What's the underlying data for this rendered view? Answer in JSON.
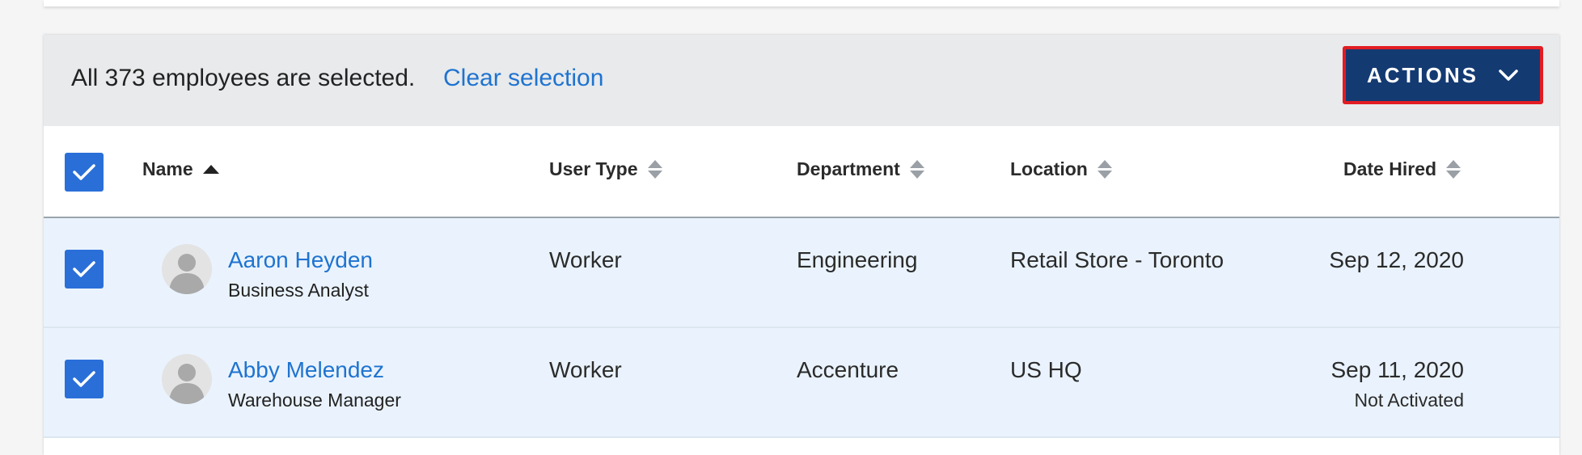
{
  "selection": {
    "message": "All 373 employees are selected.",
    "clear_label": "Clear selection",
    "actions_label": "ACTIONS"
  },
  "columns": {
    "name": "Name",
    "user_type": "User Type",
    "department": "Department",
    "location": "Location",
    "date_hired": "Date Hired"
  },
  "rows": [
    {
      "checked": true,
      "name": "Aaron Heyden",
      "title": "Business Analyst",
      "user_type": "Worker",
      "department": "Engineering",
      "location": "Retail Store - Toronto",
      "date_hired": "Sep 12, 2020",
      "status": ""
    },
    {
      "checked": true,
      "name": "Abby Melendez",
      "title": "Warehouse Manager",
      "user_type": "Worker",
      "department": "Accenture",
      "location": "US HQ",
      "date_hired": "Sep 11, 2020",
      "status": "Not Activated"
    }
  ],
  "colors": {
    "accent": "#143a72",
    "link": "#1f73d0",
    "checkbox": "#2a6fd8",
    "highlight_border": "#e21c23",
    "row_selected_bg": "#eaf3fd"
  },
  "icons": {
    "checkbox": "checkmark-icon",
    "actions": "chevron-down-icon",
    "avatar": "user-placeholder-icon",
    "sort_asc": "sort-ascending-icon",
    "sort": "sort-icon"
  }
}
